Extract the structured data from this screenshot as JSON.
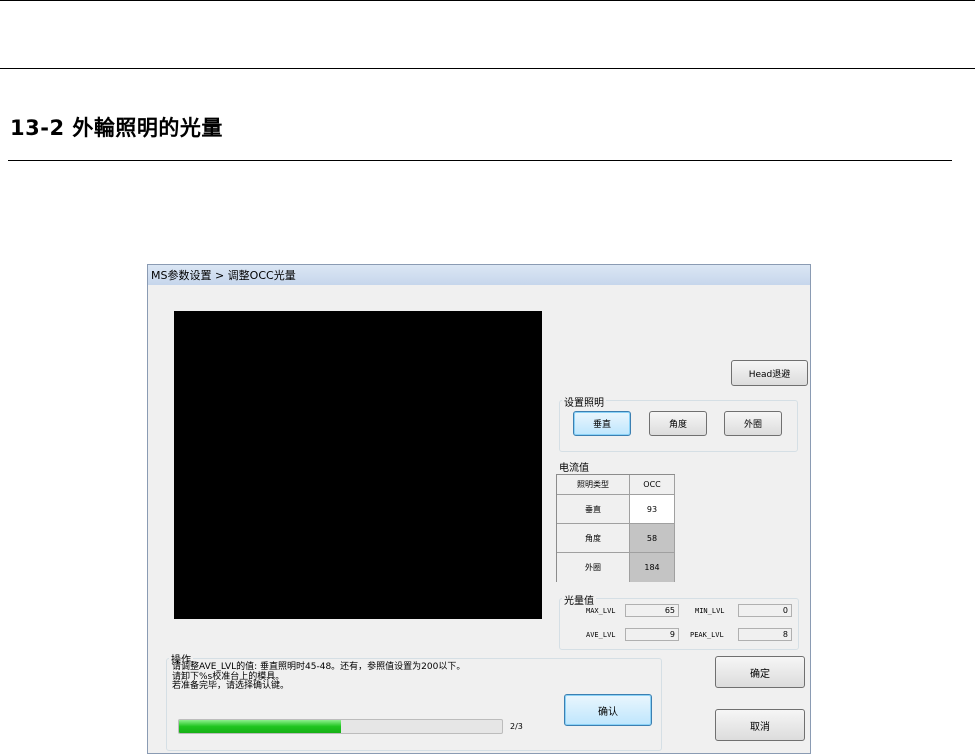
{
  "document": {
    "heading": "13-2  外輪照明的光量"
  },
  "dialog": {
    "title": "MS参数设置 > 调整OCC光量",
    "head_button": "Head退避",
    "lighting_group": {
      "label": "设置照明",
      "buttons": [
        "垂直",
        "角度",
        "外圈"
      ],
      "active": "垂直"
    },
    "current": {
      "label": "电流值",
      "header": [
        "照明类型",
        "OCC"
      ],
      "rows": [
        {
          "type": "垂直",
          "value": "93"
        },
        {
          "type": "角度",
          "value": "58"
        },
        {
          "type": "外圈",
          "value": "184"
        }
      ]
    },
    "light_level": {
      "label": "光量值",
      "max_label": "MAX_LVL",
      "max_value": "65",
      "min_label": "MIN_LVL",
      "min_value": "0",
      "ave_label": "AVE_LVL",
      "ave_value": "9",
      "peak_label": "PEAK_LVL",
      "peak_value": "8"
    },
    "operation": {
      "label": "操作",
      "lines": [
        "请调整AVE_LVL的值: 垂直照明时45-48。还有，参照值设置为200以下。",
        "请卸下%s校准台上的模具。",
        "若准备完毕，请选择确认键。"
      ],
      "confirm_button": "确认",
      "progress_fraction": 0.5,
      "progress_text": "2/3"
    },
    "ok_button": "确定",
    "cancel_button": "取消"
  }
}
